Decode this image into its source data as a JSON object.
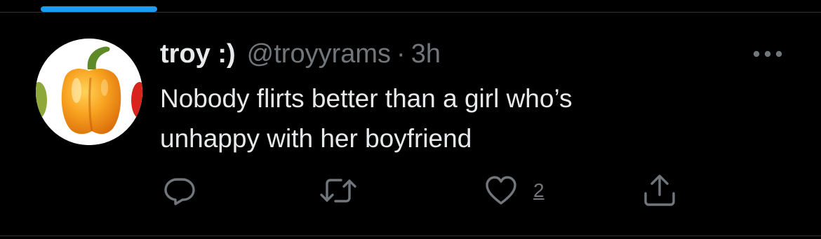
{
  "tweet": {
    "display_name": "troy :)",
    "handle": "@troyyrams",
    "separator": "·",
    "time": "3h",
    "text": "Nobody flirts better than a girl who’s\nunhappy with her boyfriend"
  },
  "actions": {
    "like_count": "2"
  },
  "icons": {
    "more": "more-horizontal-icon",
    "reply": "reply-icon",
    "retweet": "retweet-icon",
    "like": "heart-icon",
    "share": "share-icon"
  },
  "colors": {
    "background": "#000000",
    "text_primary": "#e7e9ea",
    "text_secondary": "#71767b",
    "accent": "#1d9bf0",
    "divider": "#2f3336"
  }
}
